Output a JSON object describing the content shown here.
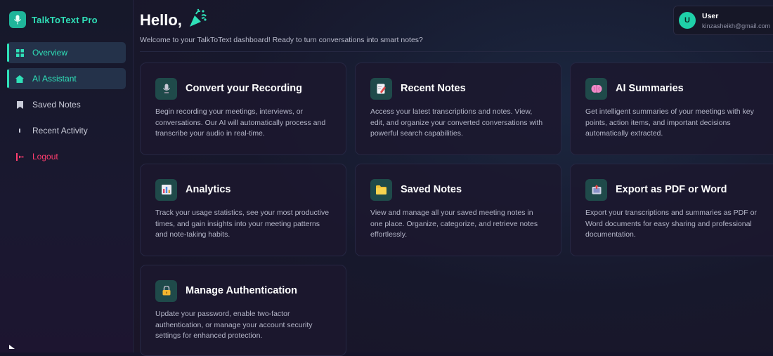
{
  "brand": {
    "name": "TalkToText Pro",
    "logo_icon": "microphone-icon",
    "accent": "#2fe0b8"
  },
  "sidebar": {
    "items": [
      {
        "label": "Overview",
        "icon": "grid-icon",
        "active": true
      },
      {
        "label": "AI Assistant",
        "icon": "home-icon",
        "active": true
      },
      {
        "label": "Saved Notes",
        "icon": "bookmark-icon",
        "active": false
      },
      {
        "label": "Recent Activity",
        "icon": "clock-icon",
        "active": false
      },
      {
        "label": "Logout",
        "icon": "logout-icon",
        "active": false,
        "color": "#ff3d6e"
      }
    ]
  },
  "header": {
    "greeting": "Hello,",
    "greeting_icon": "celebration-icon",
    "subtitle": "Welcome to your TalkToText dashboard! Ready to turn conversations into smart notes?"
  },
  "user": {
    "initial": "U",
    "name": "User",
    "email": "kinzasheikh@gmail.com"
  },
  "cards": [
    {
      "title": "Convert your Recording",
      "icon": "microphone-icon",
      "desc": "Begin recording your meetings, interviews, or conversations. Our AI will automatically process and transcribe your audio in real-time."
    },
    {
      "title": "Recent Notes",
      "icon": "memo-icon",
      "desc": "Access your latest transcriptions and notes. View, edit, and organize your converted conversations with powerful search capabilities."
    },
    {
      "title": "AI Summaries",
      "icon": "brain-icon",
      "desc": "Get intelligent summaries of your meetings with key points, action items, and important decisions automatically extracted."
    },
    {
      "title": "Analytics",
      "icon": "bar-chart-icon",
      "desc": "Track your usage statistics, see your most productive times, and gain insights into your meeting patterns and note-taking habits."
    },
    {
      "title": "Saved Notes",
      "icon": "folder-icon",
      "desc": "View and manage all your saved meeting notes in one place. Organize, categorize, and retrieve notes effortlessly."
    },
    {
      "title": "Export as PDF or Word",
      "icon": "export-document-icon",
      "desc": "Export your transcriptions and summaries as PDF or Word documents for easy sharing and professional documentation."
    },
    {
      "title": "Manage Authentication",
      "icon": "lock-icon",
      "desc": "Update your password, enable two-factor authentication, or manage your account security settings for enhanced protection."
    }
  ]
}
